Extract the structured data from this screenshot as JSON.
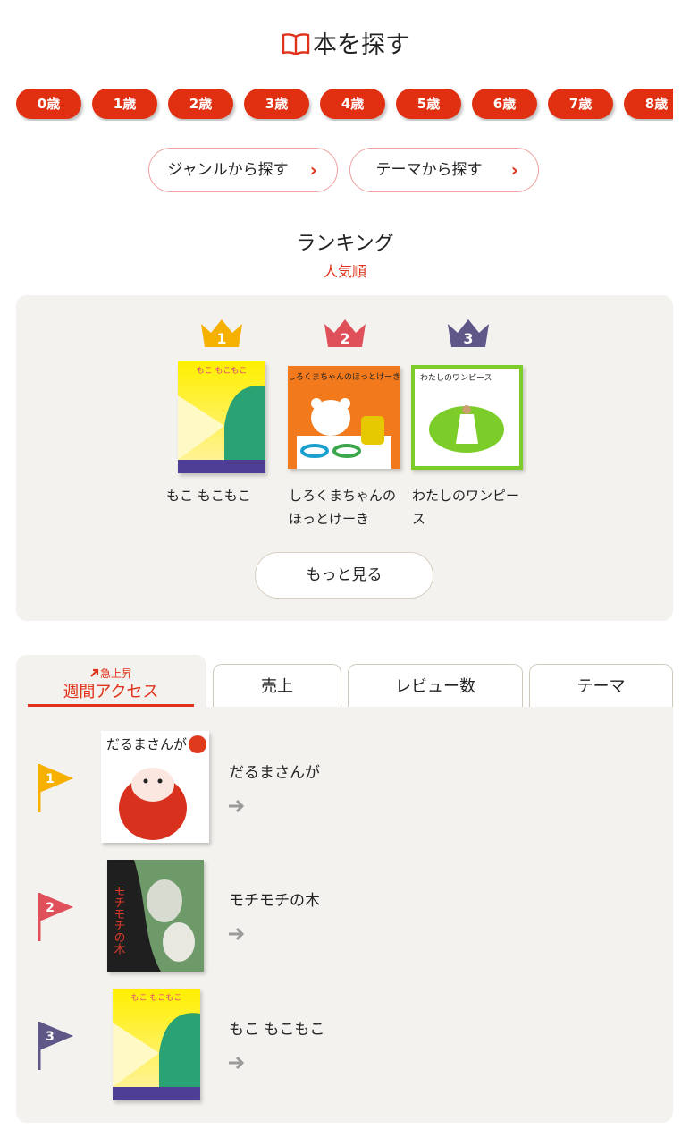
{
  "page_title": "本を探す",
  "age_buttons": [
    "0歳",
    "1歳",
    "2歳",
    "3歳",
    "4歳",
    "5歳",
    "6歳",
    "7歳",
    "8歳"
  ],
  "search_links": [
    {
      "label": "ジャンルから探す",
      "icon": "chevron-right-icon"
    },
    {
      "label": "テーマから探す",
      "icon": "chevron-right-icon"
    }
  ],
  "ranking": {
    "heading": "ランキング",
    "sort_label": "人気順",
    "books": [
      {
        "rank": "1",
        "title": "もこ もこもこ",
        "crown_color": "#f5b000"
      },
      {
        "rank": "2",
        "title": "しろくまちゃんのほっとけーき",
        "crown_color": "#e0505a"
      },
      {
        "rank": "3",
        "title": "わたしのワンピース",
        "crown_color": "#5e5787"
      }
    ],
    "more_label": "もっと見る"
  },
  "tabs": {
    "active": {
      "label": "週間アクセス",
      "sublabel": "急上昇"
    },
    "others": [
      "売上",
      "レビュー数",
      "テーマ"
    ]
  },
  "list": [
    {
      "rank": "1",
      "title": "だるまさんが",
      "flag_color": "#f5b000"
    },
    {
      "rank": "2",
      "title": "モチモチの木",
      "flag_color": "#e0505a"
    },
    {
      "rank": "3",
      "title": "もこ もこもこ",
      "flag_color": "#5e5787"
    }
  ],
  "cover_texts": {
    "moko": "もこ もこもこ",
    "shirokuma": "しろくまちゃんのほっとけーき",
    "wanpisu": "わたしのワンピース",
    "daruma": "だるまさんが",
    "mochimochi": "モチモチの木"
  },
  "colors": {
    "accent": "#e03011",
    "panel": "#f4f2ee"
  }
}
